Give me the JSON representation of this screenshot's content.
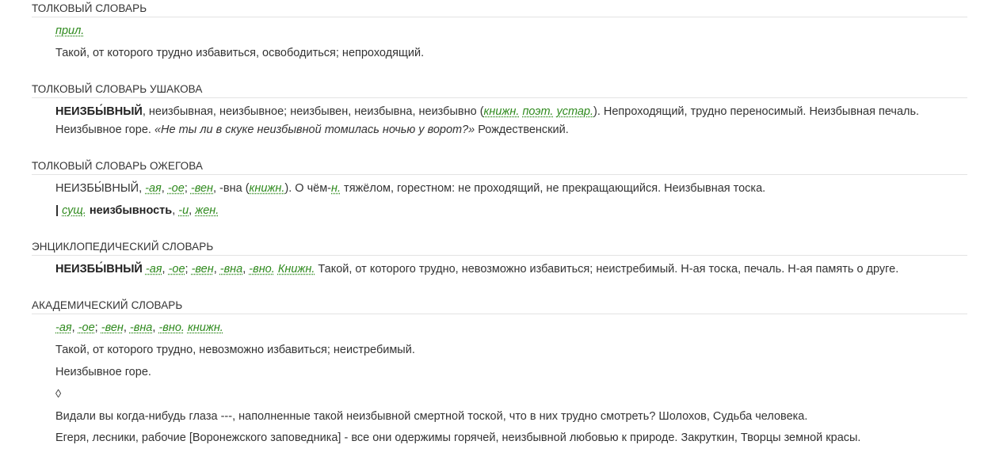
{
  "s1": {
    "title": "ТОЛКОВЫЙ СЛОВАРЬ",
    "pos": "прил.",
    "def": "Такой, от которого трудно избавиться, освободиться; непроходящий."
  },
  "s2": {
    "title": "ТОЛКОВЫЙ СЛОВАРЬ УШАКОВА",
    "head": "НЕИЗБЫ́ВНЫЙ",
    "forms": ", неизбывная, неизбывное; неизбывен, неизбывна, неизбывно (",
    "a1": "книжн.",
    "a2": "поэт.",
    "a3": "устар.",
    "def": "). Непроходящий, трудно переносимый. Неизбывная печаль.",
    "ex_start": "Неизбывное горе. ",
    "quote": "«Не ты ли в скуке неизбывной томилась ночью у ворот?»",
    "author": " Рождественский."
  },
  "s3": {
    "title": "ТОЛКОВЫЙ СЛОВАРЬ ОЖЕГОВА",
    "head": "НЕИЗБЫ́ВНЫЙ, ",
    "e1": "-ая",
    "e2": "-ое",
    "e3": "-вен",
    "e4": ", -вна (",
    "a1": "книжн.",
    "mid": "). О чём-",
    "a2": "н.",
    "def": " тяжёлом, горестном: не проходящий, не прекращающийся. Неизбывная тоска.",
    "bar": "| ",
    "n1": "сущ.",
    "noun": "неизбывность",
    "n2": "-и",
    "n3": "жен."
  },
  "s4": {
    "title": "ЭНЦИКЛОПЕДИЧЕСКИЙ СЛОВАРЬ",
    "head": "НЕИЗБЫ́ВНЫЙ",
    "e1": "-ая",
    "e2": "-ое",
    "e3": "-вен",
    "e4": "-вна",
    "e5": "-вно.",
    "a1": "Книжн.",
    "def": " Такой, от которого трудно, невозможно избавиться; неистребимый. Н-ая тоска, печаль. Н-ая память о друге."
  },
  "s5": {
    "title": "АКАДЕМИЧЕСКИЙ СЛОВАРЬ",
    "e1": "-ая",
    "e2": "-ое",
    "e3": "-вен",
    "e4": "-вна",
    "e5": "-вно.",
    "a1": "книжн.",
    "def": "Такой, от которого трудно, невозможно избавиться; неистребимый.",
    "ex1": "Неизбывное горе.",
    "diamond": "◊",
    "ex2": "Видали вы когда-нибудь глаза ---, наполненные такой неизбывной смертной тоской, что в них трудно смотреть? Шолохов, Судьба человека.",
    "ex3": "Егеря, лесники, рабочие [Воронежского заповедника] - все они одержимы горячей, неизбывной любовью к природе. Закруткин, Творцы земной красы."
  }
}
